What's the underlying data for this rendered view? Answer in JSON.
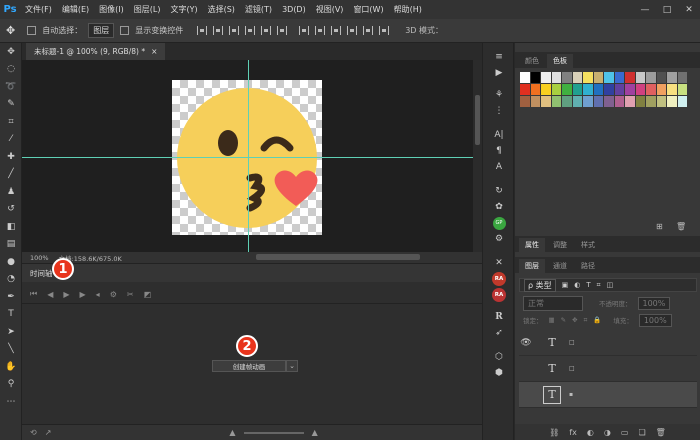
{
  "app": {
    "logo": "Ps"
  },
  "menubar": {
    "items": [
      "文件(F)",
      "编辑(E)",
      "图像(I)",
      "图层(L)",
      "文字(Y)",
      "选择(S)",
      "滤镜(T)",
      "3D(D)",
      "视图(V)",
      "窗口(W)",
      "帮助(H)"
    ],
    "win_minimize": "—",
    "win_restore": "□",
    "win_close": "✕"
  },
  "options": {
    "move_glyph": "✥",
    "auto_select_label": "自动选择：",
    "auto_select_value": "图层",
    "show_transform_label": "显示变换控件",
    "mode3d_label": "3D 模式："
  },
  "document": {
    "tab_title": "未标题-1 @ 100% (9, RGB/8) *",
    "tab_close": "×",
    "status_zoom": "100%",
    "status_doc": "文档:158.6K/675.0K"
  },
  "timeline": {
    "title": "时间轴",
    "create_button": "创建帧动画",
    "ctrl_first": "⏮",
    "ctrl_prev": "◀",
    "ctrl_play": "▶",
    "ctrl_next": "▶",
    "ctrl_audio": "◂",
    "ctrl_settings": "⚙",
    "ctrl_cut": "✂",
    "ctrl_transition": "◩"
  },
  "annotations": {
    "badge1": "1",
    "badge2": "2"
  },
  "panels": {
    "color_tabs": [
      "颜色",
      "色板"
    ],
    "layer_tabs_top": [
      "属性",
      "调整",
      "样式"
    ],
    "layer_tabs": [
      "图层",
      "通道",
      "路径"
    ],
    "filter_label": "ρ 类型",
    "blend_mode": "正常",
    "opacity_label": "不透明度：",
    "opacity_value": "100%",
    "lock_label": "锁定：",
    "fill_label": "填充：",
    "fill_value": "100%",
    "layers": [
      {
        "glyph": "T",
        "name": "□",
        "visible": true,
        "selected": false,
        "framed": false
      },
      {
        "glyph": "T",
        "name": "□",
        "visible": false,
        "selected": false,
        "framed": false
      },
      {
        "glyph": "T",
        "name": "▪",
        "visible": false,
        "selected": true,
        "framed": true
      }
    ],
    "footer_icons": [
      "⛓",
      "fx",
      "◐",
      "◑",
      "▭",
      "❏",
      "🗑"
    ],
    "ra_label": "RA",
    "green_label": "GP"
  },
  "swatch_colors": [
    [
      "#ffffff",
      "#000000",
      "#f0f0f0",
      "#e0e0e0",
      "#808080",
      "#d8d0b8",
      "#f5e060",
      "#c8b070",
      "#4fc3e8",
      "#3a6bd0",
      "#d03030",
      "#c8c8c8",
      "#9c9c9c",
      "#505050",
      "#a0a0a0",
      "#707070"
    ],
    [
      "#e03020",
      "#f07020",
      "#f8d020",
      "#a8d040",
      "#40b040",
      "#20a090",
      "#30b0d0",
      "#2070c0",
      "#3040a0",
      "#6040a0",
      "#a040a0",
      "#d04080",
      "#e06060",
      "#f0a060",
      "#f8e080",
      "#c8e080"
    ],
    [
      "#a06040",
      "#c09060",
      "#e0c080",
      "#90c070",
      "#60a080",
      "#60b0b0",
      "#70a0d0",
      "#6070b0",
      "#806090",
      "#b06090",
      "#e0a0b0",
      "#808040",
      "#a0a060",
      "#c0c080",
      "#f0f0c0",
      "#d0f0f0"
    ]
  ]
}
